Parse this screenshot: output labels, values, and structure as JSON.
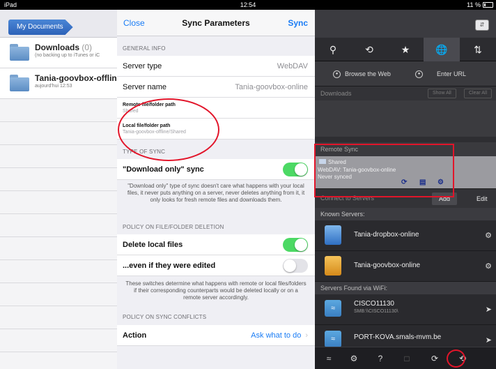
{
  "status_bar": {
    "device": "iPad",
    "time": "12:54",
    "battery": "11 %"
  },
  "left_panel": {
    "my_documents": "My Documents",
    "items": [
      {
        "title": "Downloads",
        "count": "(0)",
        "subtitle": "(no backing up to iTunes or iC"
      },
      {
        "title": "Tania-goovbox-offline",
        "count": "",
        "subtitle": "aujourd'hui 12:53"
      }
    ]
  },
  "sync_panel": {
    "close_label": "Close",
    "title": "Sync Parameters",
    "sync_label": "Sync",
    "general_info_header": "GENERAL INFO",
    "server_type_label": "Server type",
    "server_type_value": "WebDAV",
    "server_name_label": "Server name",
    "server_name_value": "Tania-goovbox-online",
    "remote_path_label": "Remote file/folder path",
    "remote_path_value": "Shared",
    "local_path_label": "Local file/folder path",
    "local_path_value": "Tania-goovbox-offline/Shared",
    "type_of_sync_header": "TYPE OF SYNC",
    "download_only_label": "\"Download only\" sync",
    "download_only_on": true,
    "download_only_note": "\"Download only\" type of sync doesn't care what happens with your local files, it never puts anything on a server, never deletes anything from it, it only looks for fresh remote files and downloads them.",
    "deletion_header": "POLICY ON FILE/FOLDER DELETION",
    "delete_local_label": "Delete local files",
    "delete_local_on": true,
    "even_edited_label": "...even if they were edited",
    "even_edited_on": false,
    "deletion_note": "These switches determine what happens with remote or local files/folders if their corresponding counterparts would be deleted locally or on a remote server accordingly.",
    "conflicts_header": "POLICY ON SYNC CONFLICTS",
    "action_label": "Action",
    "action_value": "Ask what to do"
  },
  "right_panel": {
    "browse_web": "Browse the Web",
    "enter_url": "Enter URL",
    "downloads_label": "Downloads",
    "show_all": "Show All",
    "clear_all": "Clear All",
    "remote_sync_header": "Remote Sync",
    "remote_item_name": "Shared",
    "remote_item_server": "WebDAV: Tania-goovbox-online",
    "remote_item_status": "Never synced",
    "connect_header": "Connect to Servers",
    "add_label": "Add",
    "edit_label": "Edit",
    "known_servers_header": "Known Servers:",
    "known_servers": [
      {
        "name": "Tania-dropbox-online"
      },
      {
        "name": "Tania-goovbox-online"
      }
    ],
    "wifi_header": "Servers Found via WiFi:",
    "wifi_servers": [
      {
        "name": "CISCO11130",
        "sub": "SMB:\\\\CISCO11130\\"
      },
      {
        "name": "PORT-KOVA.smals-mvm.be",
        "sub": ""
      }
    ]
  },
  "colors": {
    "ios_blue": "#1a7cf5",
    "toggle_green": "#4cd964",
    "annotation_red": "#e2152a",
    "dark_panel": "#28282d"
  }
}
